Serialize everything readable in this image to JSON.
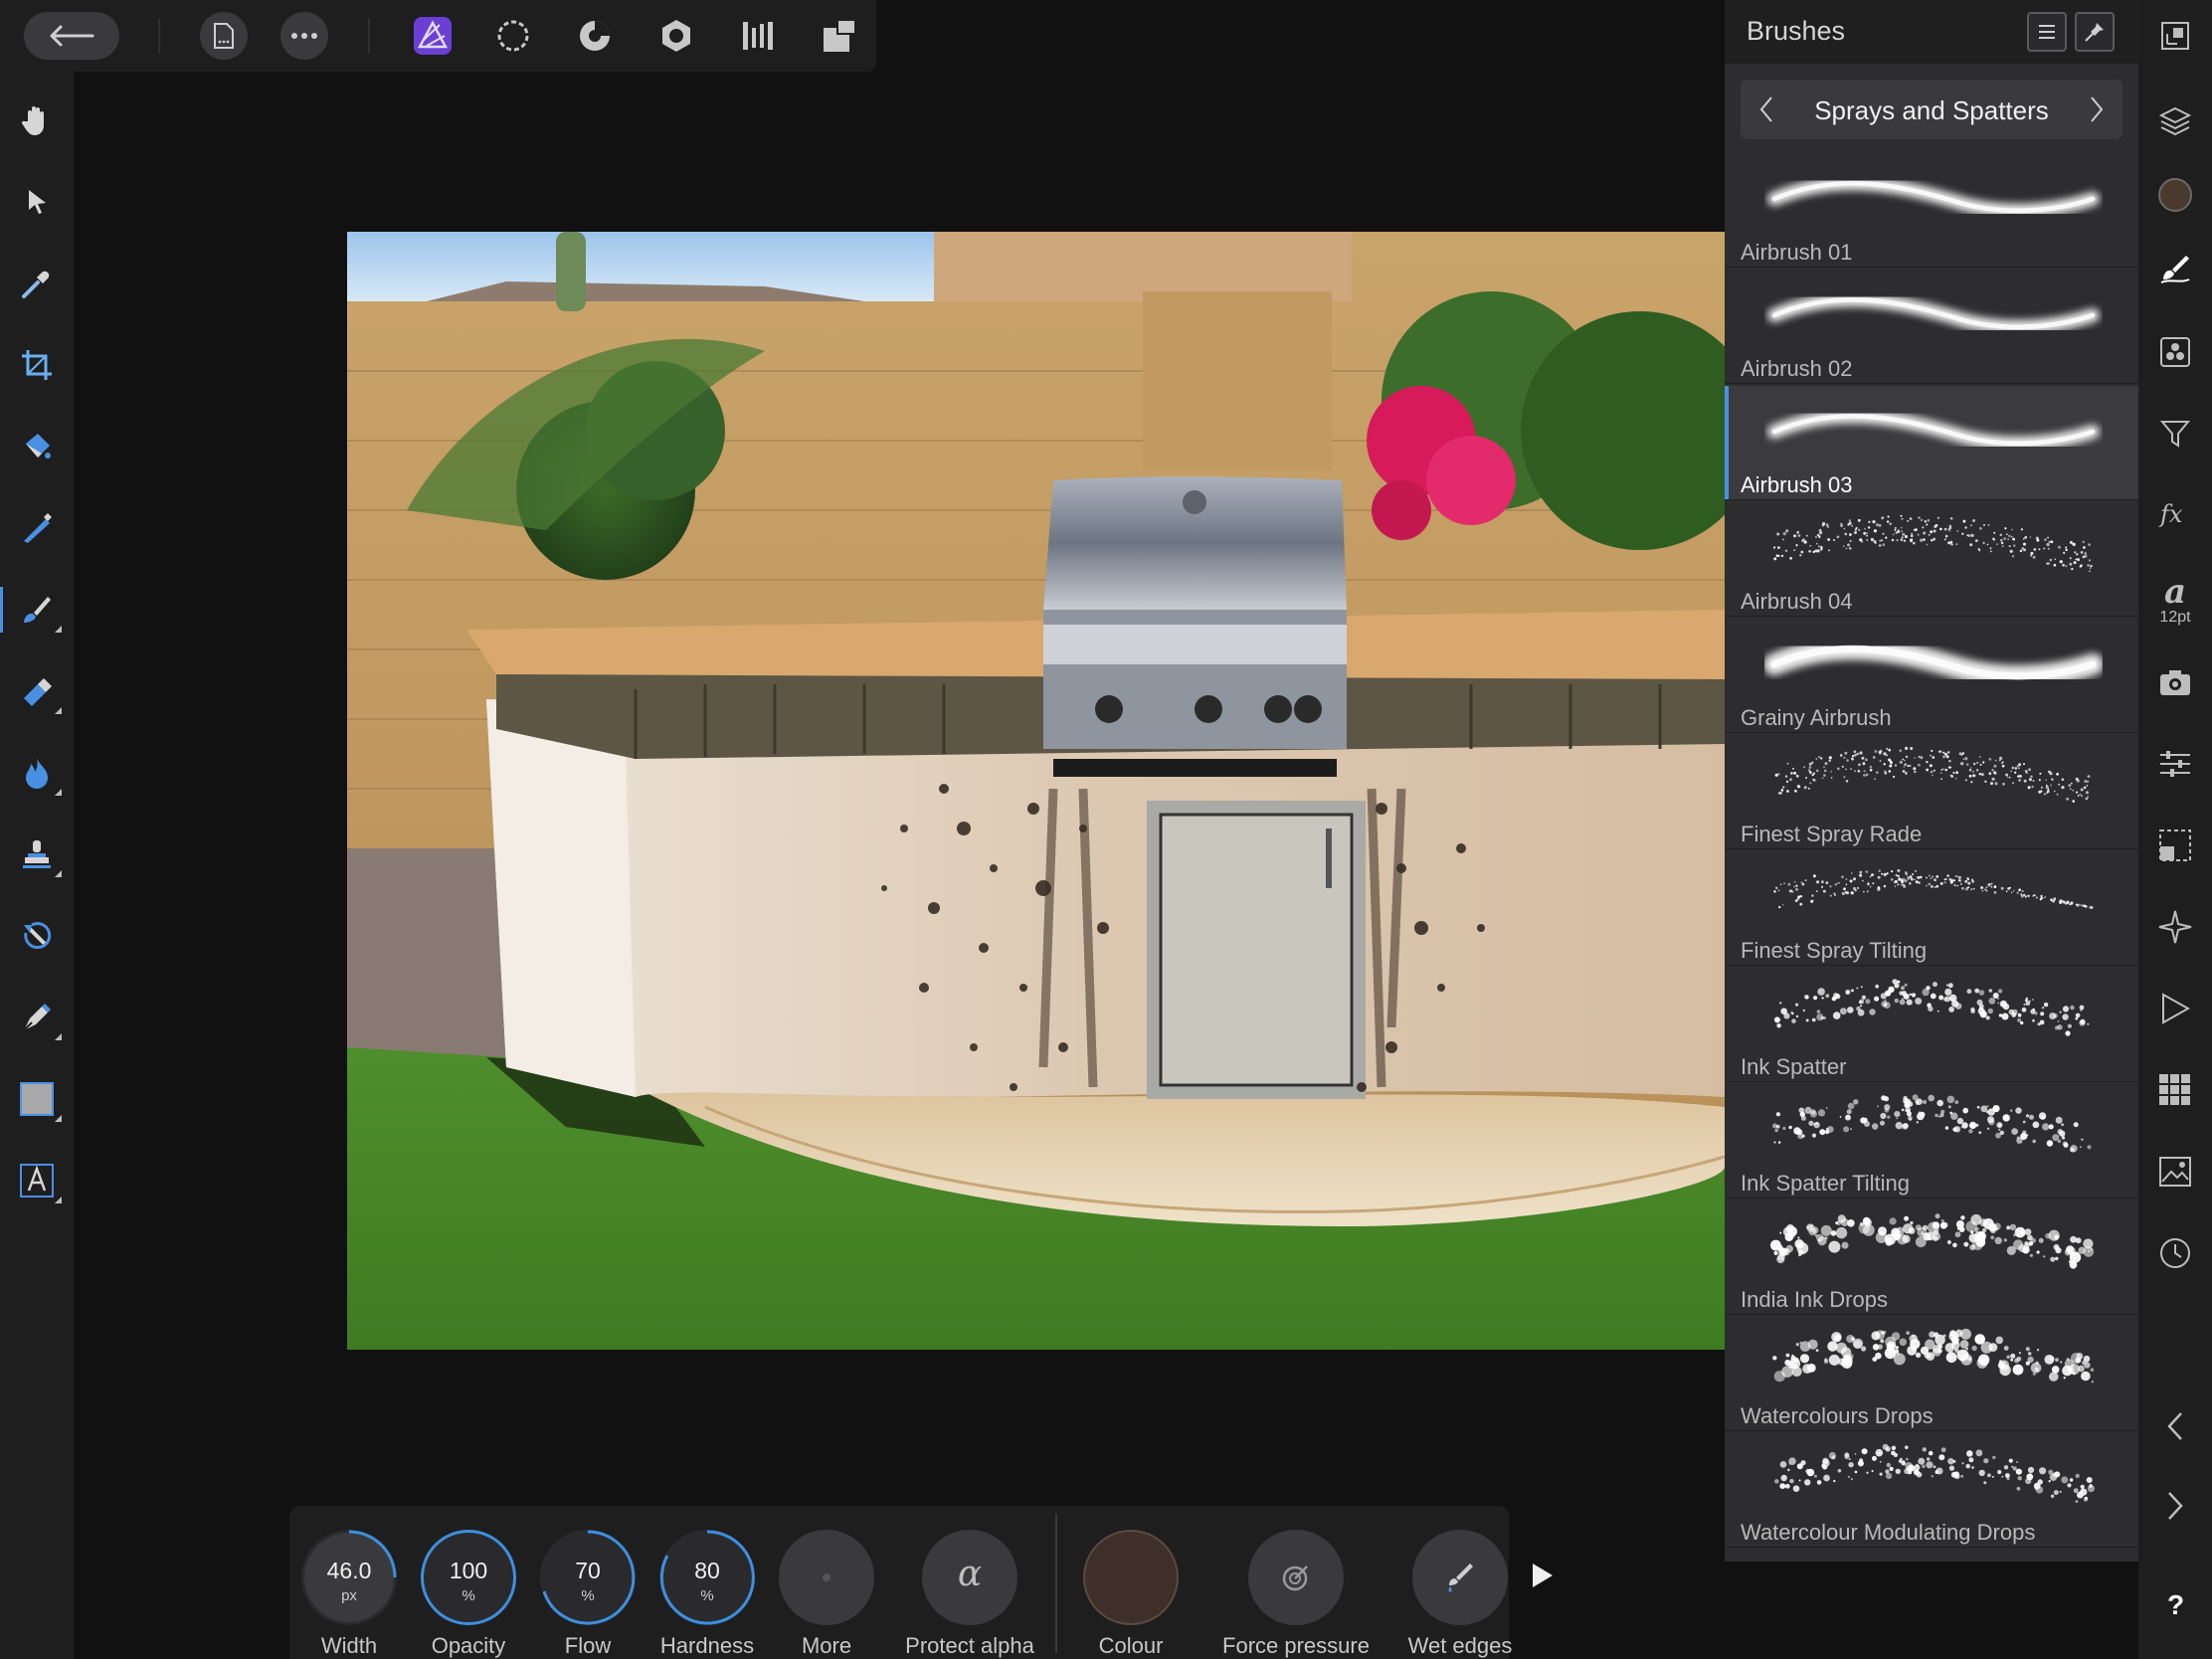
{
  "toolbar": {
    "back": "back-arrow-icon",
    "document": "document-icon",
    "more": "more-icon",
    "personas": [
      "photo-persona-icon",
      "liquify-persona-icon",
      "develop-persona-icon",
      "tone-mapping-persona-icon",
      "export-persona-icon",
      "layout-icon"
    ]
  },
  "tools": [
    {
      "name": "hand-tool",
      "icon": "hand-icon"
    },
    {
      "name": "move-tool",
      "icon": "pointer-icon"
    },
    {
      "name": "color-picker-tool",
      "icon": "eyedropper-icon"
    },
    {
      "name": "crop-tool",
      "icon": "crop-icon"
    },
    {
      "name": "flood-fill-tool",
      "icon": "paint-bucket-icon"
    },
    {
      "name": "selection-brush-tool",
      "icon": "selection-brush-icon"
    },
    {
      "name": "paint-brush-tool",
      "icon": "paint-brush-icon",
      "active": true
    },
    {
      "name": "erase-brush-tool",
      "icon": "eraser-icon"
    },
    {
      "name": "burn-brush-tool",
      "icon": "flame-icon"
    },
    {
      "name": "clone-brush-tool",
      "icon": "stamp-icon"
    },
    {
      "name": "undo-brush-tool",
      "icon": "undo-brush-icon"
    },
    {
      "name": "pen-tool",
      "icon": "pen-icon"
    },
    {
      "name": "rectangle-tool",
      "icon": "rectangle-icon"
    },
    {
      "name": "text-tool",
      "icon": "text-icon"
    }
  ],
  "brushes_panel": {
    "title": "Brushes",
    "category": "Sprays and Spatters",
    "brushes": [
      {
        "name": "Airbrush 01",
        "style": "soft"
      },
      {
        "name": "Airbrush 02",
        "style": "soft"
      },
      {
        "name": "Airbrush 03",
        "style": "soft",
        "selected": true
      },
      {
        "name": "Airbrush 04",
        "style": "grainy"
      },
      {
        "name": "Grainy Airbrush",
        "style": "soft-bold"
      },
      {
        "name": "Finest Spray Rade",
        "style": "grainy"
      },
      {
        "name": "Finest Spray Tilting",
        "style": "tilting"
      },
      {
        "name": "Ink Spatter",
        "style": "spatter"
      },
      {
        "name": "Ink Spatter Tilting",
        "style": "spatter"
      },
      {
        "name": "India Ink Drops",
        "style": "drops"
      },
      {
        "name": "Watercolours Drops",
        "style": "drops"
      },
      {
        "name": "Watercolour Modulating Drops",
        "style": "spatter"
      }
    ]
  },
  "studio": {
    "icons": [
      "navigator-icon",
      "layers-icon",
      "color-icon",
      "brushes-icon",
      "channels-icon",
      "adjustments-icon",
      "effects-icon",
      "text-style-icon",
      "snapshots-icon",
      "sliders-icon",
      "transform-icon",
      "navigator-compass-icon",
      "macro-play-icon",
      "swatches-icon",
      "stock-icon",
      "history-icon",
      "collapse-left-icon",
      "collapse-right-icon",
      "help-icon"
    ],
    "text_size": "12pt",
    "color_swatch": "#4a3a2e"
  },
  "context": {
    "width": {
      "value": "46.0",
      "unit": "px",
      "label": "Width"
    },
    "opacity": {
      "value": "100",
      "unit": "%",
      "label": "Opacity"
    },
    "flow": {
      "value": "70",
      "unit": "%",
      "label": "Flow"
    },
    "hardness": {
      "value": "80",
      "unit": "%",
      "label": "Hardness"
    },
    "more": {
      "label": "More"
    },
    "protect_alpha": {
      "label": "Protect alpha",
      "glyph": "α"
    },
    "colour": {
      "label": "Colour",
      "value": "#3e3029"
    },
    "force_pressure": {
      "label": "Force pressure"
    },
    "wet_edges": {
      "label": "Wet edges"
    }
  }
}
